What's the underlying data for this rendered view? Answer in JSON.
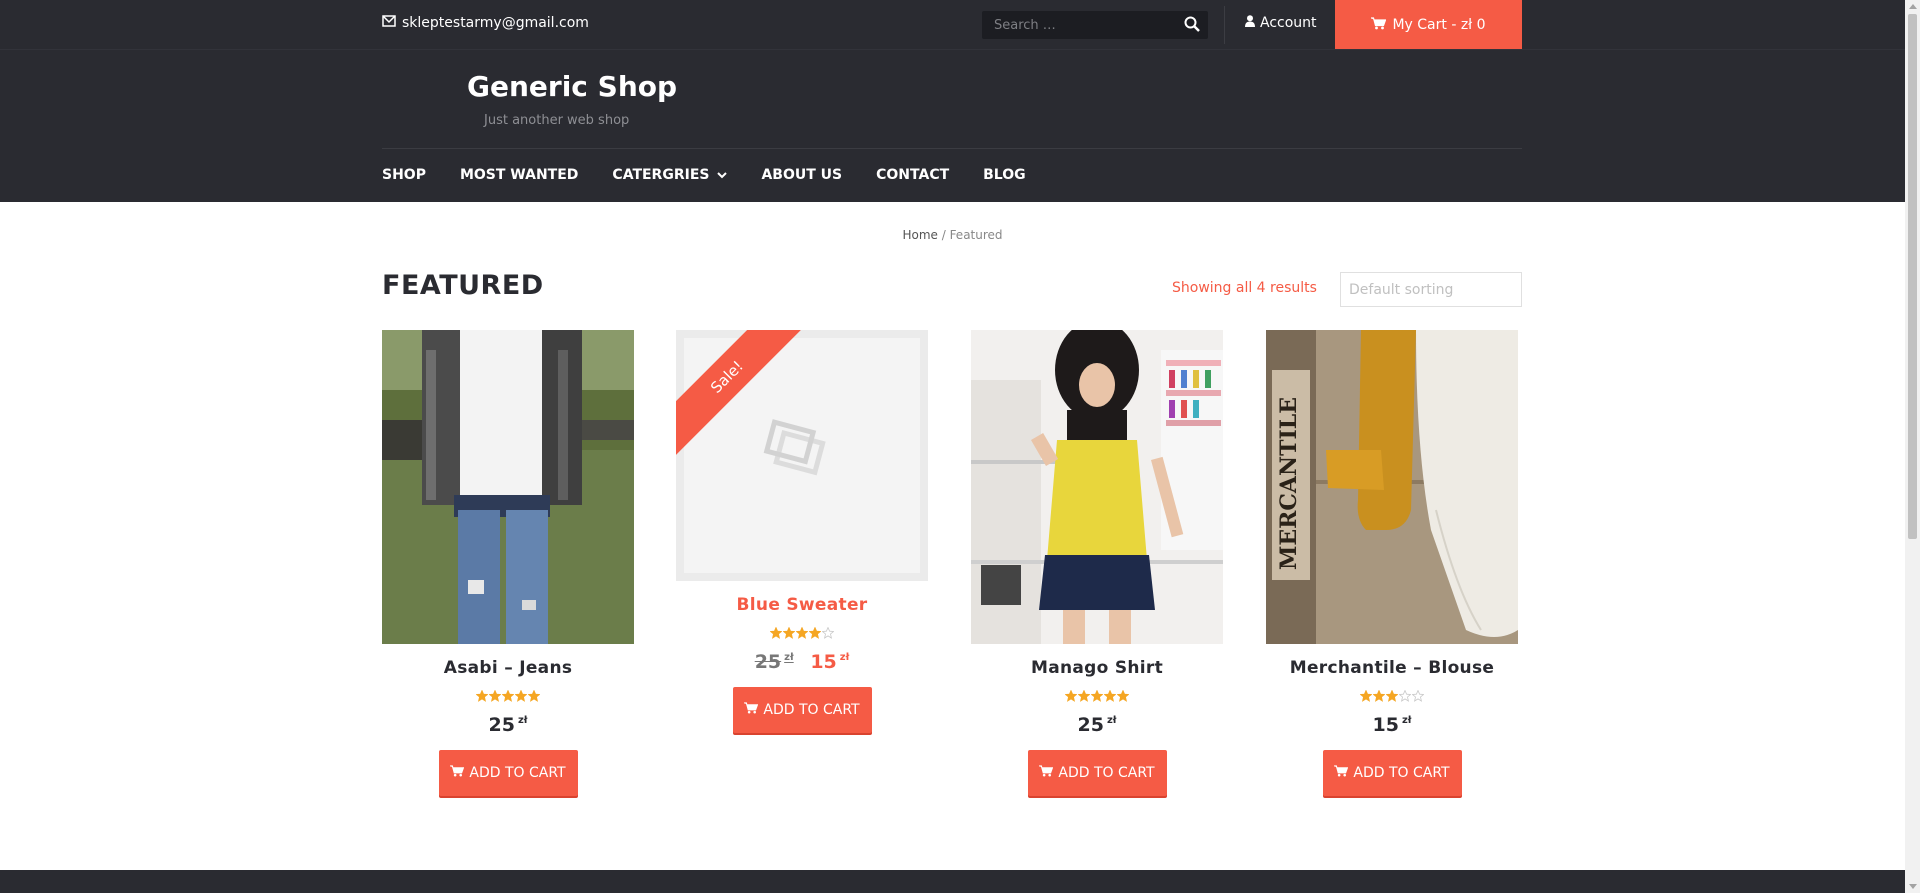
{
  "topbar": {
    "email": "skleptestarmy@gmail.com",
    "search_placeholder": "Search …",
    "account": "Account",
    "cart": "My Cart - zł 0"
  },
  "header": {
    "title": "Generic Shop",
    "subtitle": "Just another web shop",
    "nav": [
      "SHOP",
      "MOST WANTED",
      "CATERGRIES",
      "ABOUT US",
      "CONTACT",
      "BLOG"
    ]
  },
  "breadcrumb": {
    "home": "Home",
    "sep": " / ",
    "current": "Featured"
  },
  "page": {
    "title": "FEATURED",
    "results": "Showing all 4 results",
    "sorting": "Default sorting"
  },
  "colors": {
    "accent": "#f55b45",
    "dark": "#2a2b31",
    "star": "#f5a623"
  },
  "products": [
    {
      "name": "Asabi – Jeans",
      "rating": 5,
      "price": "25",
      "currency": "zł",
      "button": "ADD TO CART"
    },
    {
      "name": "Blue Sweater",
      "rating": 4,
      "old_price": "25",
      "price": "15",
      "currency": "zł",
      "badge": "Sale!",
      "button": "ADD TO CART"
    },
    {
      "name": "Manago Shirt",
      "rating": 5,
      "price": "25",
      "currency": "zł",
      "button": "ADD TO CART"
    },
    {
      "name": "Merchantile – Blouse",
      "rating": 3,
      "price": "15",
      "currency": "zł",
      "image_text": "MERCANTILE",
      "button": "ADD TO CART"
    }
  ]
}
